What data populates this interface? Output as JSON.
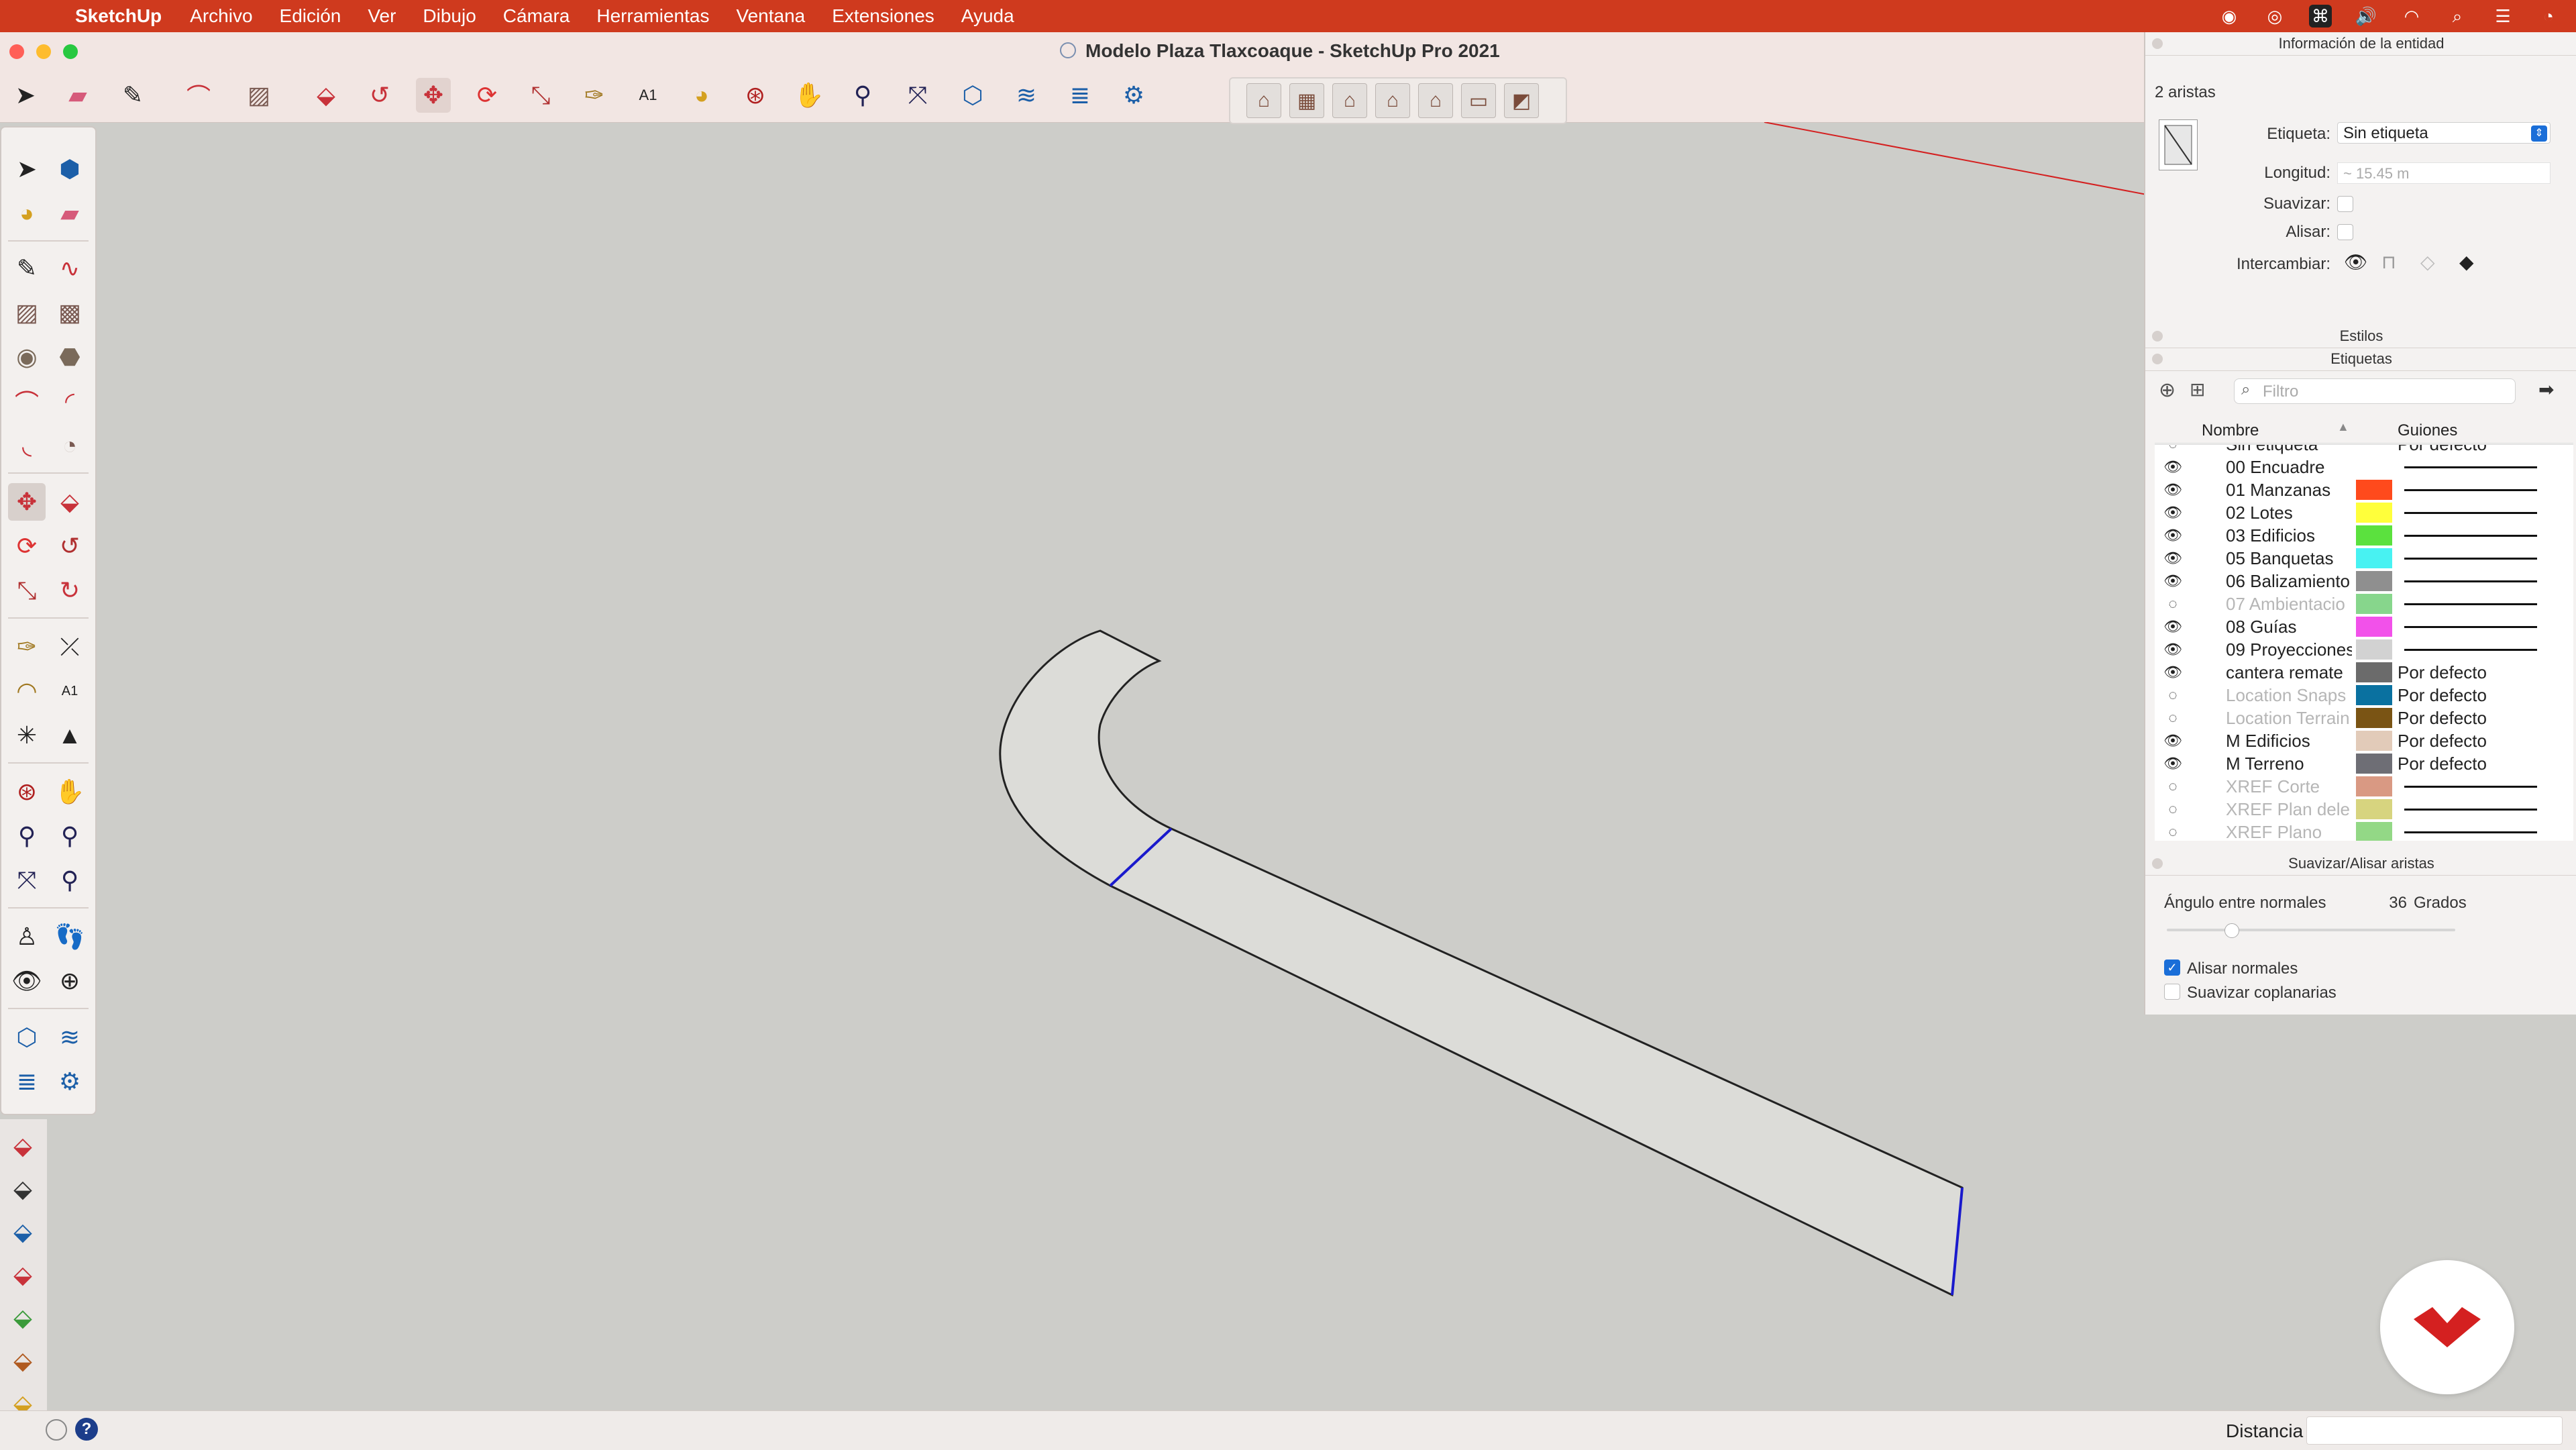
{
  "menubar": {
    "app_name": "SketchUp",
    "items": [
      "Archivo",
      "Edición",
      "Ver",
      "Dibujo",
      "Cámara",
      "Herramientas",
      "Ventana",
      "Extensiones",
      "Ayuda"
    ],
    "status_icons": [
      "creative-cloud-icon",
      "sync-icon",
      "command-icon",
      "volume-icon",
      "wifi-icon",
      "search-icon",
      "control-center-icon",
      "clock-icon"
    ]
  },
  "window": {
    "title": "Modelo Plaza Tlaxcoaque  - SketchUp Pro 2021",
    "traffic_colors": [
      "#ff5f57",
      "#febc2e",
      "#28c840"
    ]
  },
  "toolbar": {
    "tools": [
      "select-icon",
      "eraser-icon",
      "pencil-icon",
      "arc-icon",
      "rectangle-icon",
      "push-pull-icon",
      "follow-me-icon",
      "move-icon",
      "rotate-icon",
      "scale-icon",
      "tape-measure-icon",
      "text-icon",
      "paint-bucket-icon",
      "orbit-icon",
      "pan-icon",
      "zoom-icon",
      "zoom-extents-icon",
      "3d-warehouse-icon",
      "extension-warehouse-icon",
      "layout-icon",
      "extension-manager-icon"
    ],
    "views": [
      "iso-view-icon",
      "top-view-icon",
      "front-view-icon",
      "right-view-icon",
      "back-view-icon",
      "left-view-icon",
      "bottom-view-icon"
    ]
  },
  "entity_info": {
    "panel_title": "Información de la entidad",
    "selection": "2 aristas",
    "tag_label": "Etiqueta:",
    "tag_value": "Sin etiqueta",
    "length_label": "Longitud:",
    "length_value": "~ 15.45 m",
    "soften_label": "Suavizar:",
    "smooth_label": "Alisar:",
    "toggle_label": "Intercambiar:"
  },
  "styles": {
    "panel_title": "Estilos"
  },
  "tags": {
    "panel_title": "Etiquetas",
    "filter_placeholder": "Filtro",
    "col_name": "Nombre",
    "col_dashes": "Guiones",
    "partial_top": {
      "name": "Sin etiqueta",
      "dashes": "Por defecto"
    },
    "rows": [
      {
        "name": "00 Encuadre",
        "visible": true,
        "color": "",
        "dashes": "solid"
      },
      {
        "name": "01 Manzanas",
        "visible": true,
        "color": "#ff4a1c",
        "dashes": "solid"
      },
      {
        "name": "02 Lotes",
        "visible": true,
        "color": "#ffff3b",
        "dashes": "solid"
      },
      {
        "name": "03 Edificios",
        "visible": true,
        "color": "#5be13e",
        "dashes": "solid"
      },
      {
        "name": "05 Banquetas",
        "visible": true,
        "color": "#48f2f2",
        "dashes": "solid"
      },
      {
        "name": "06 Balizamiento",
        "visible": true,
        "color": "#8f8f8f",
        "dashes": "solid"
      },
      {
        "name": "07 Ambientacio",
        "visible": false,
        "color": "#87d68c",
        "dashes": "solid"
      },
      {
        "name": "08 Guías",
        "visible": true,
        "color": "#f251ea",
        "dashes": "solid"
      },
      {
        "name": "09 Proyecciones",
        "visible": true,
        "color": "#d2d2d2",
        "dashes": "solid"
      },
      {
        "name": "cantera remate",
        "visible": true,
        "color": "#6b6b6b",
        "dashes": "Por defecto"
      },
      {
        "name": "Location Snaps",
        "visible": false,
        "color": "#0a71a0",
        "dashes": "Por defecto"
      },
      {
        "name": "Location Terrain",
        "visible": false,
        "color": "#7a5414",
        "dashes": "Por defecto"
      },
      {
        "name": "M Edificios",
        "visible": true,
        "color": "#e2cbb9",
        "dashes": "Por defecto"
      },
      {
        "name": "M Terreno",
        "visible": true,
        "color": "#6e6e75",
        "dashes": "Por defecto"
      },
      {
        "name": "XREF Corte",
        "visible": false,
        "color": "#d99983",
        "dashes": "solid"
      },
      {
        "name": "XREF Plan dele",
        "visible": false,
        "color": "#d7d47f",
        "dashes": "solid"
      },
      {
        "name": "XREF Plano",
        "visible": false,
        "color": "#93d886",
        "dashes": "solid"
      }
    ]
  },
  "soften": {
    "panel_title": "Suavizar/Alisar aristas",
    "angle_label": "Ángulo entre normales",
    "angle_value": "36",
    "angle_unit": "Grados",
    "smooth_normals": "Alisar normales",
    "soften_coplanar": "Suavizar coplanarias"
  },
  "statusbar": {
    "distance_label": "Distancia",
    "help": "?"
  },
  "colors": {
    "menubar": "#cf3a1e",
    "selection_edge": "#1a1acc",
    "axis_red": "#d42020",
    "badge": "#d42020"
  }
}
